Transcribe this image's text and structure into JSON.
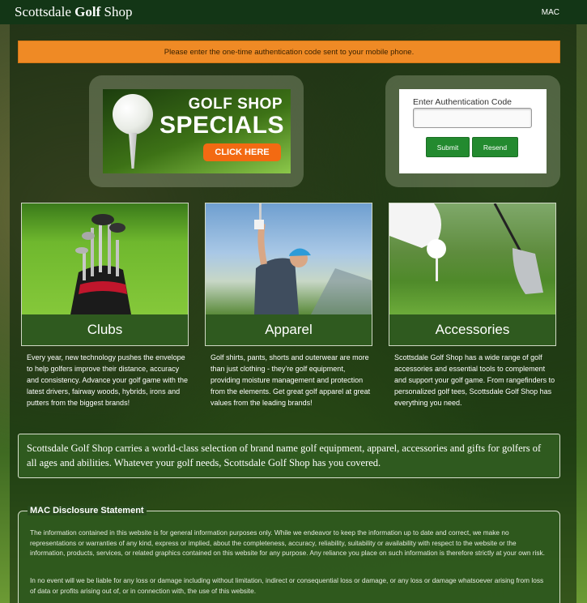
{
  "header": {
    "brand_prefix": "Scottsdale",
    "brand_bold": "Golf",
    "brand_suffix": "Shop",
    "mac_link": "MAC"
  },
  "alert": {
    "message": "Please enter the one-time authentication code sent to your mobile phone.",
    "color": "#ef8a25"
  },
  "promo": {
    "line1": "GOLF SHOP",
    "line2": "SPECIALS",
    "cta": "CLICK HERE",
    "cta_color": "#f36a12"
  },
  "auth": {
    "label": "Enter Authentication Code",
    "input_value": "",
    "input_placeholder": "",
    "submit_label": "Submit",
    "resend_label": "Resend",
    "button_color": "#238a2f"
  },
  "categories": [
    {
      "name": "Clubs",
      "image_icon": "golf-bag-icon",
      "description": "Every year, new technology pushes the envelope to help golfers improve their distance, accuracy and consistency. Advance your golf game with the latest drivers, fairway woods, hybrids, irons and putters from the biggest brands!"
    },
    {
      "name": "Apparel",
      "image_icon": "golfer-icon",
      "description": "Golf shirts, pants, shorts and outerwear are more than just clothing - they're golf equipment, providing moisture management and protection from the elements. Get great golf apparel at great values from the leading brands!"
    },
    {
      "name": "Accessories",
      "image_icon": "golf-ball-tee-icon",
      "description": "Scottsdale Golf Shop has a wide range of golf accessories and essential tools to complement and support your golf game. From rangefinders to personalized golf tees, Scottsdale Golf Shop has everything you need."
    }
  ],
  "summary": "Scottsdale Golf Shop carries a world-class selection of brand name golf equipment, apparel, accessories and gifts for golfers of all ages and abilities. Whatever your golf needs, Scottsdale Golf Shop has you covered.",
  "disclosure": {
    "title": "MAC Disclosure Statement",
    "paragraph1": "The information contained in this website is for general information purposes only. While we endeavor to keep the information up to date and correct, we make no representations or warranties of any kind, express or implied, about the completeness, accuracy, reliability, suitability or availability with respect to the website or the information, products, services, or related graphics contained on this website for any purpose. Any reliance you place on such information is therefore strictly at your own risk.",
    "paragraph2": "In no event will we be liable for any loss or damage including without limitation, indirect or consequential loss or damage, or any loss or damage whatsoever arising from loss of data or profits arising out of, or in connection with, the use of this website."
  },
  "theme": {
    "header_bg": "#133616",
    "card_caption_bg": "#2f5a1f"
  }
}
